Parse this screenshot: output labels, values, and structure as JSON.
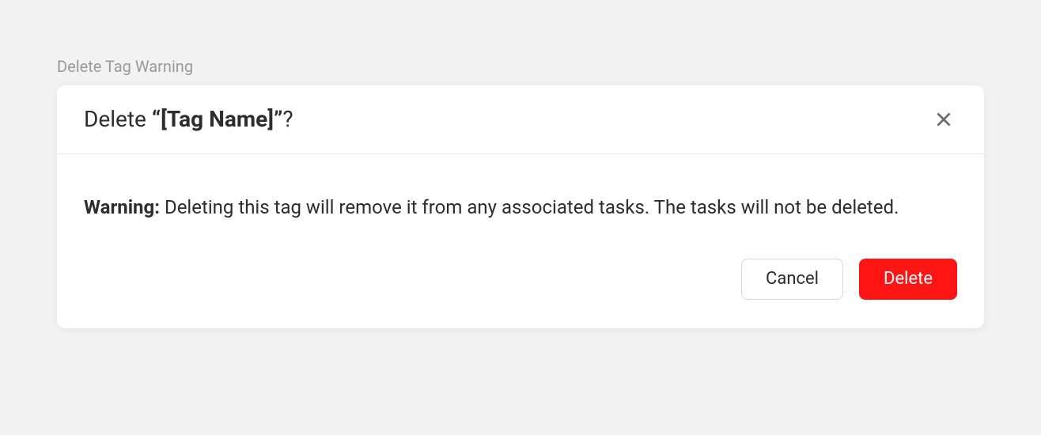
{
  "caption": "Delete Tag Warning",
  "dialog": {
    "title_prefix": "Delete ",
    "title_bold": "“[Tag Name]”",
    "title_suffix": "?",
    "warning_label": "Warning:",
    "warning_text": " Deleting this tag will remove it from any associated tasks. The tasks will not be deleted.",
    "cancel_label": "Cancel",
    "delete_label": "Delete"
  }
}
